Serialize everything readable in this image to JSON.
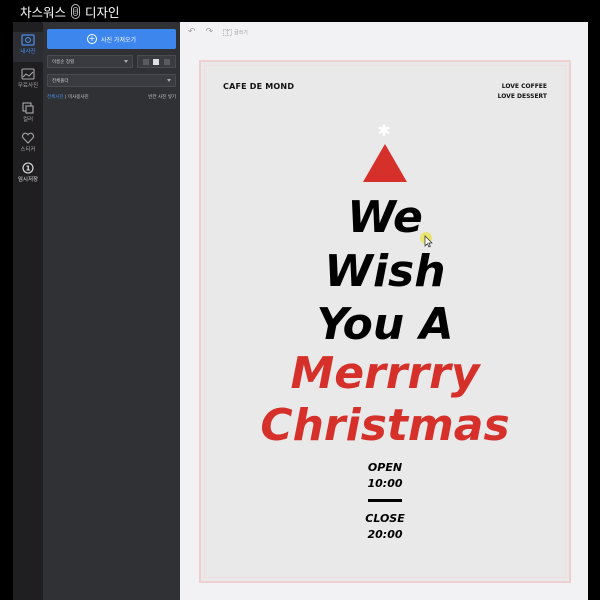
{
  "window": {
    "title_prefix": "차스워스",
    "title_suffix": "디자인"
  },
  "rail": {
    "items": [
      {
        "label": "내사진",
        "icon": "photo-icon",
        "active": true
      },
      {
        "label": "무료사진",
        "icon": "free-photo-icon",
        "active": false
      },
      {
        "label": "컬러",
        "icon": "color-icon",
        "active": false
      },
      {
        "label": "스티커",
        "icon": "heart-icon",
        "active": false
      },
      {
        "label": "임시저장",
        "icon": "save-icon",
        "active": false
      }
    ]
  },
  "panel": {
    "upload_label": "사진 가져오기",
    "sort_value": "이름순 정렬",
    "folder_value": "전체폴더",
    "filter_all": "전체사진",
    "filter_unused": "미사용사진",
    "filter_right": "빈칸 사진 넣기"
  },
  "toolbar": {
    "undo_icon": "undo-icon",
    "redo_icon": "redo-icon",
    "text_tool_label": "글쓰기"
  },
  "poster": {
    "brand": "CAFE DE MOND",
    "tagline_1": "LOVE COFFEE",
    "tagline_2": "LOVE DESSERT",
    "star": "✱",
    "line_1": "We",
    "line_2": "Wish",
    "line_3": "You A",
    "line_4": "Merrrry",
    "line_5": "Christmas",
    "open_label": "OPEN",
    "open_time": "10:00",
    "close_label": "CLOSE",
    "close_time": "20:00",
    "colors": {
      "red": "#d6302a",
      "black": "#000000",
      "background": "#e9e9ea",
      "border": "#f0cfd0"
    }
  },
  "theme": {
    "accent": "#3d86ee",
    "rail_bg": "#1f1f22",
    "panel_bg": "#303135"
  }
}
